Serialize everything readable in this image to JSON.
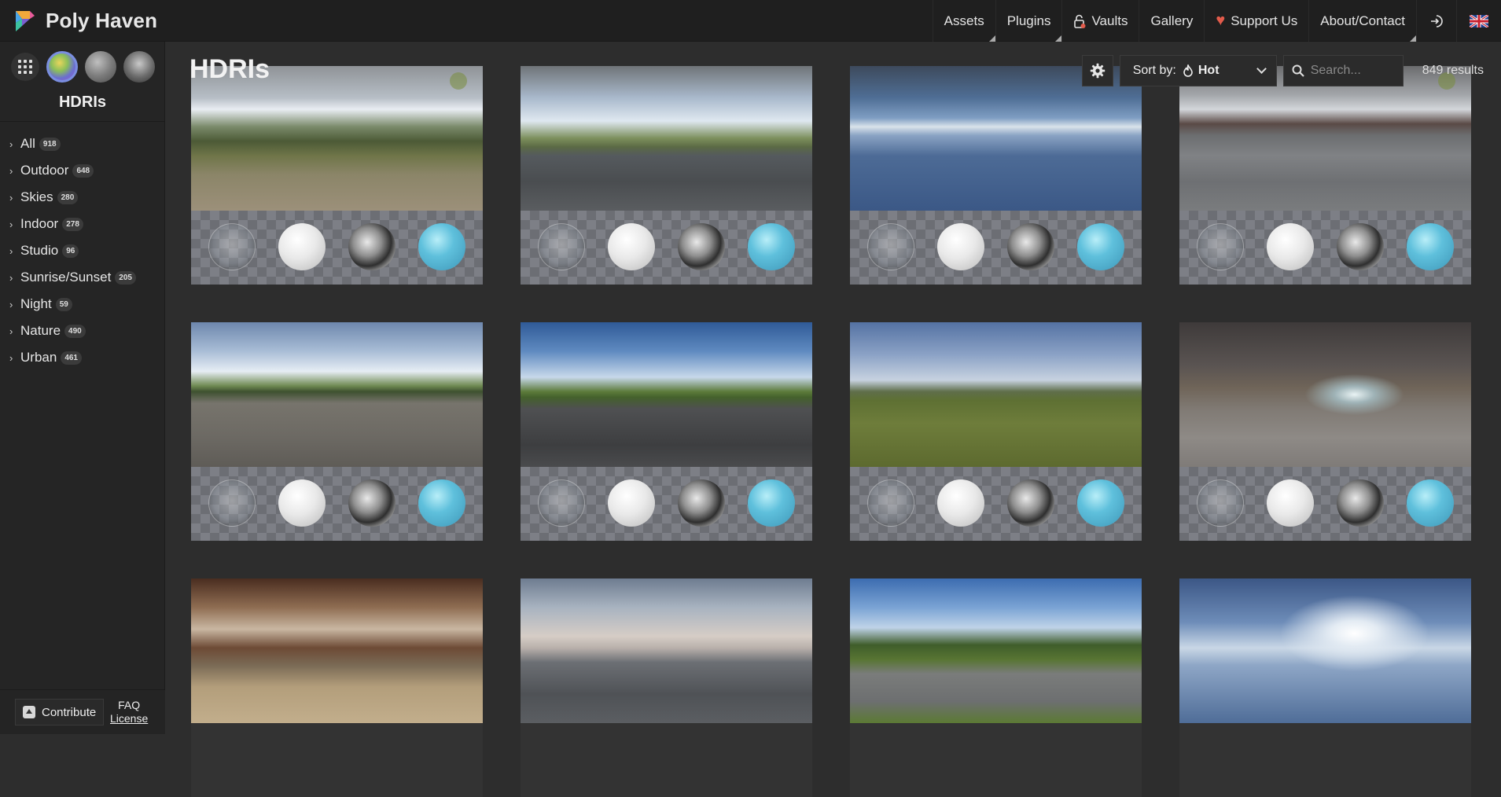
{
  "brand": {
    "name": "Poly Haven"
  },
  "nav": {
    "items": [
      {
        "label": "Assets"
      },
      {
        "label": "Plugins"
      },
      {
        "label": "Vaults"
      },
      {
        "label": "Gallery"
      },
      {
        "label": "Support Us"
      },
      {
        "label": "About/Contact"
      }
    ]
  },
  "sidebar": {
    "title": "HDRIs",
    "categories": [
      {
        "label": "All",
        "count": "918"
      },
      {
        "label": "Outdoor",
        "count": "648"
      },
      {
        "label": "Skies",
        "count": "280"
      },
      {
        "label": "Indoor",
        "count": "278"
      },
      {
        "label": "Studio",
        "count": "96"
      },
      {
        "label": "Sunrise/Sunset",
        "count": "205"
      },
      {
        "label": "Night",
        "count": "59"
      },
      {
        "label": "Nature",
        "count": "490"
      },
      {
        "label": "Urban",
        "count": "461"
      }
    ],
    "footer": {
      "contribute": "Contribute",
      "faq": "FAQ",
      "license": "License"
    }
  },
  "main": {
    "title": "HDRIs",
    "sort_label": "Sort by:",
    "sort_value": "Hot",
    "search_placeholder": "Search...",
    "results": "849 results"
  },
  "thumbnails": [
    {
      "theme": "park-path"
    },
    {
      "theme": "road"
    },
    {
      "theme": "blue-sky"
    },
    {
      "theme": "plaza"
    },
    {
      "theme": "parking-lot"
    },
    {
      "theme": "country-road"
    },
    {
      "theme": "meadow"
    },
    {
      "theme": "night-city"
    },
    {
      "theme": "interior-hall"
    },
    {
      "theme": "cloudy-sea"
    },
    {
      "theme": "trees-path"
    },
    {
      "theme": "bright-sky"
    }
  ]
}
